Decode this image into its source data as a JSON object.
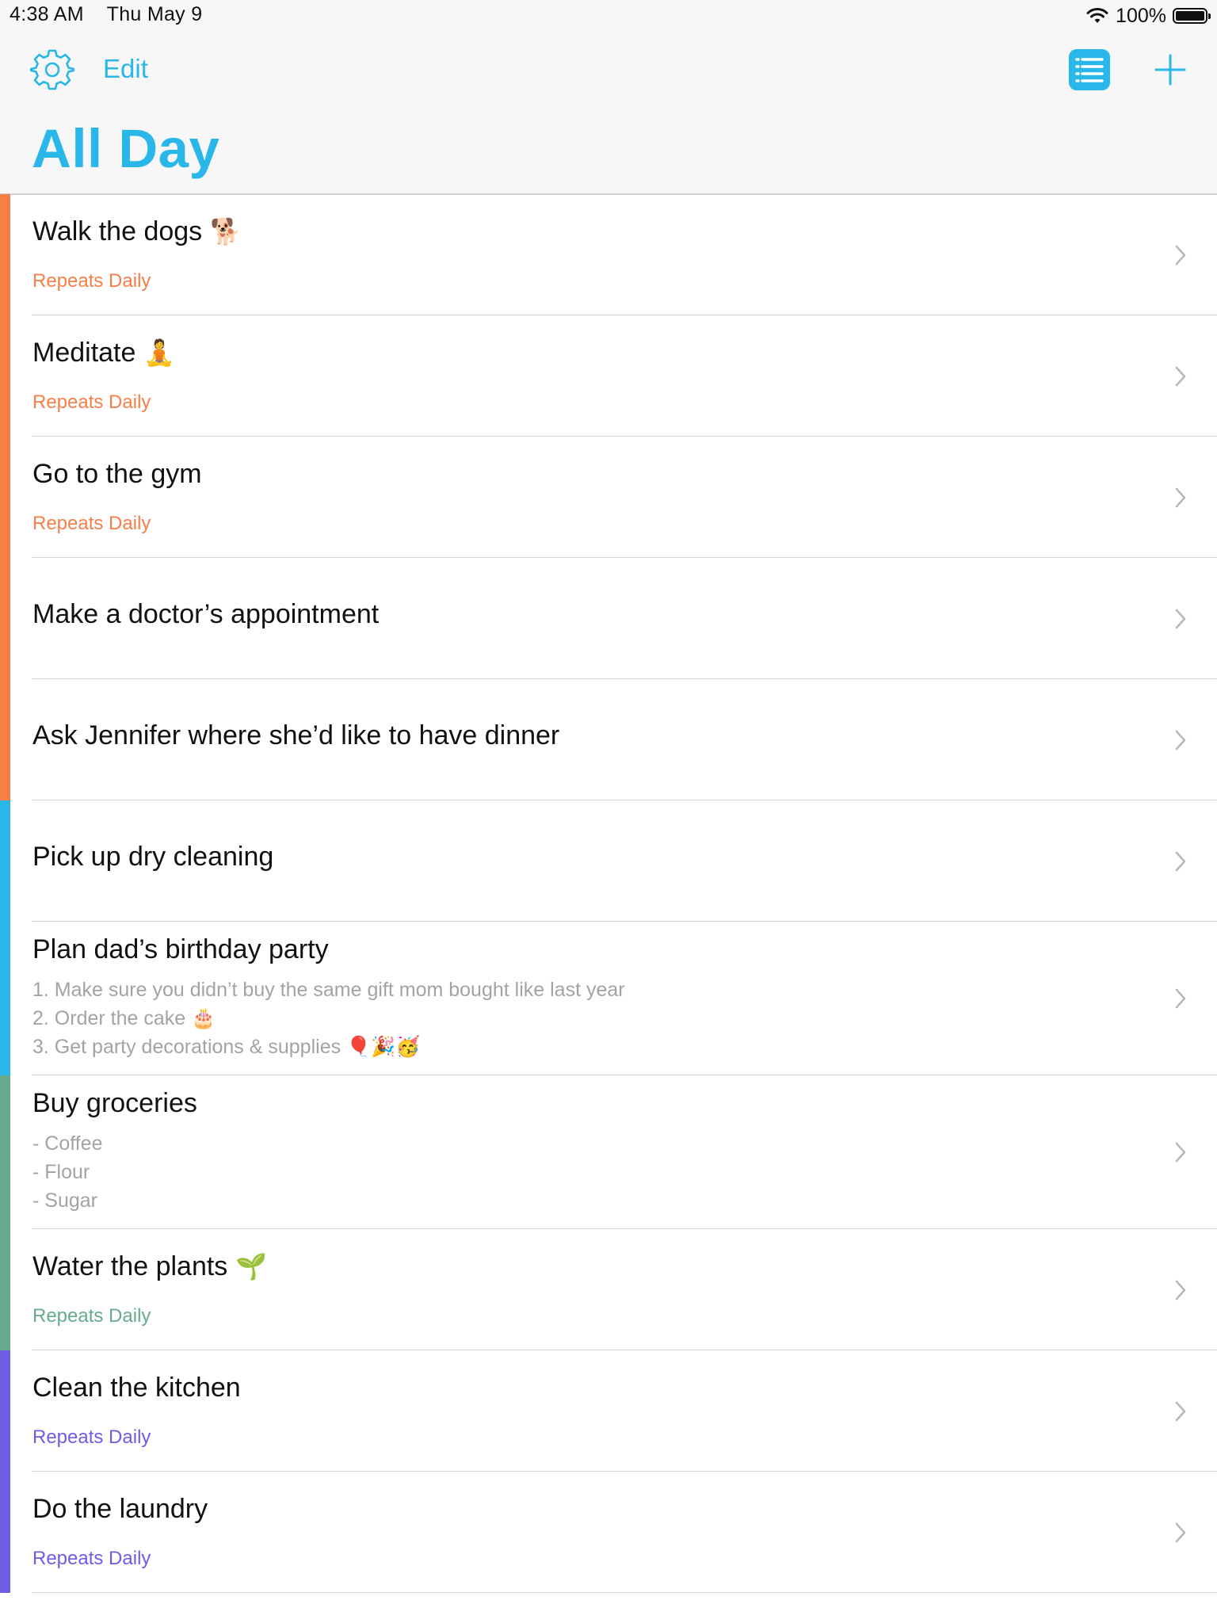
{
  "status": {
    "time": "4:38 AM",
    "date": "Thu May 9",
    "battery": "100%",
    "battery_level": 1.0
  },
  "nav": {
    "gear_icon": "gear-icon",
    "edit_label": "Edit",
    "list_icon": "list-icon",
    "plus_icon": "plus-icon",
    "title": "All Day"
  },
  "colors": {
    "accent": "#29b6e8",
    "orange": "#f77e47",
    "blue": "#29b6e8",
    "green": "#67ab8c",
    "purple": "#6f5ce7"
  },
  "tasks": [
    {
      "title": "Walk the dogs",
      "emoji": "🐕",
      "sub": "Repeats Daily",
      "color": "orange"
    },
    {
      "title": "Meditate",
      "emoji": "🧘",
      "sub": "Repeats Daily",
      "color": "orange"
    },
    {
      "title": "Go to the gym",
      "sub": "Repeats Daily",
      "color": "orange"
    },
    {
      "title": "Make a doctor’s appointment",
      "color": "orange"
    },
    {
      "title": "Ask Jennifer where she’d like to have dinner",
      "color": "orange"
    },
    {
      "title": "Pick up dry cleaning",
      "color": "blue"
    },
    {
      "title": "Plan dad’s birthday party",
      "color": "blue",
      "notes": [
        "1. Make sure you didn’t buy the same gift mom bought like last year",
        "2. Order the cake 🎂",
        "3. Get party decorations & supplies 🎈🎉🥳"
      ]
    },
    {
      "title": "Buy groceries",
      "color": "green",
      "notes": [
        "- Coffee",
        "- Flour",
        "- Sugar"
      ]
    },
    {
      "title": "Water the plants",
      "emoji": "🌱",
      "sub": "Repeats Daily",
      "color": "green"
    },
    {
      "title": "Clean the kitchen",
      "sub": "Repeats Daily",
      "color": "purple"
    },
    {
      "title": "Do the laundry",
      "sub": "Repeats Daily",
      "color": "purple"
    }
  ]
}
